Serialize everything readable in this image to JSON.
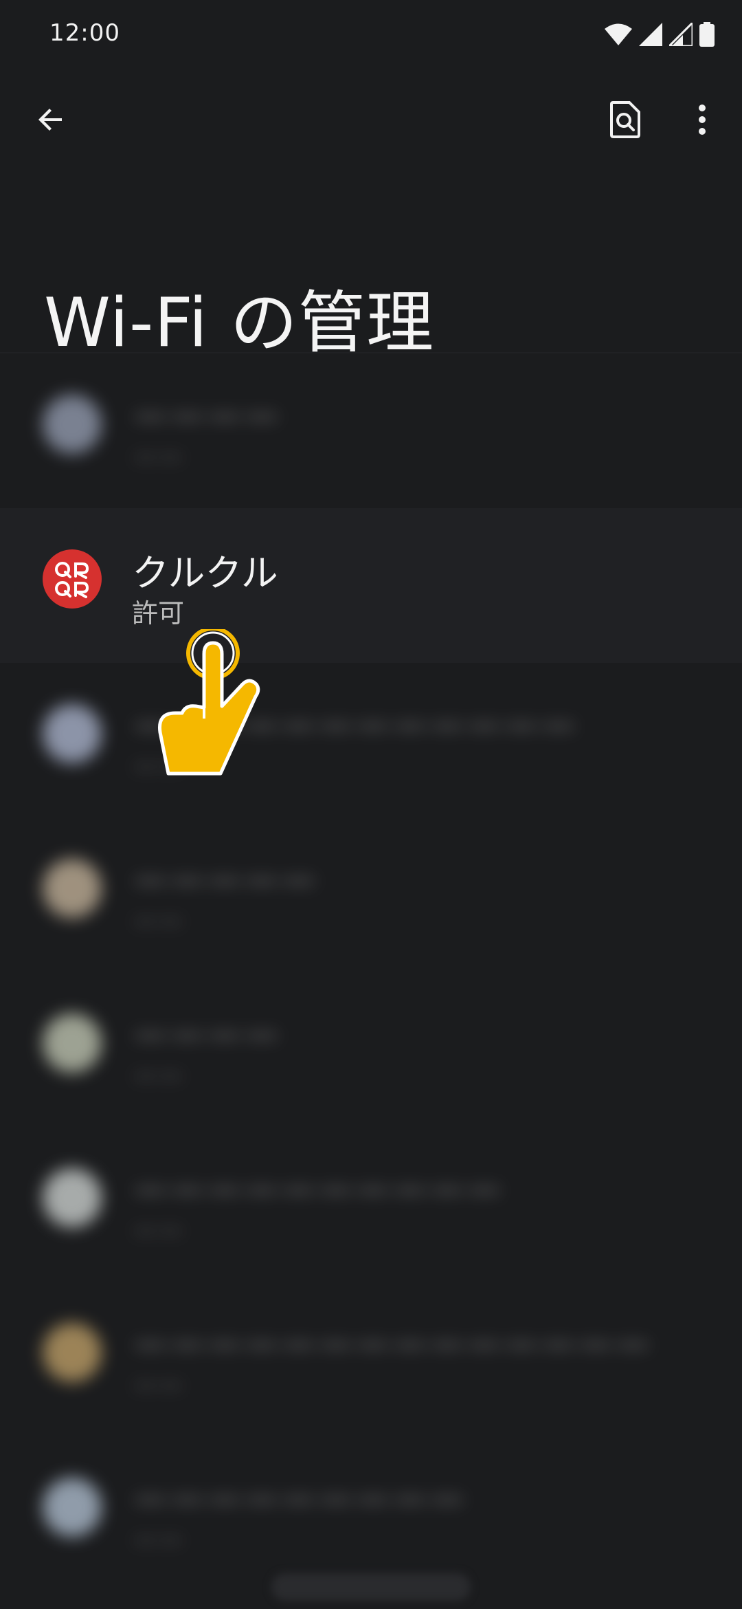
{
  "status_bar": {
    "time": "12:00",
    "icons": [
      "wifi-icon",
      "signal-full-icon",
      "signal-partial-icon",
      "battery-icon"
    ]
  },
  "app_bar": {
    "back_icon": "arrow-back-icon",
    "search_doc_icon": "search-document-icon",
    "more_icon": "more-vert-icon"
  },
  "title": "Wi-Fi の管理",
  "apps": [
    {
      "name": "ーーーー",
      "status": "ーー",
      "icon_color": "#9aa3b8",
      "blurred": true
    },
    {
      "name": "クルクル",
      "status": "許可",
      "icon_color": "#d6312f",
      "blurred": false,
      "icon": "qr-code-app-icon"
    },
    {
      "name": "ーーーーーーーーーーーー",
      "status": "ーー",
      "icon_color": "#b2bcd6",
      "blurred": true
    },
    {
      "name": "ーーーーー",
      "status": "ーー",
      "icon_color": "#cbb99f",
      "blurred": true
    },
    {
      "name": "ーーーー",
      "status": "ーー",
      "icon_color": "#c9cfba",
      "blurred": true
    },
    {
      "name": "ーーーーーーーーーー",
      "status": "ーー",
      "icon_color": "#d6dbd9",
      "blurred": true
    },
    {
      "name": "ーーーーーーーーーーーーーー",
      "status": "ーー",
      "icon_color": "#c7a66b",
      "blurred": true
    },
    {
      "name": "ーーーーーーーーー",
      "status": "ーー",
      "icon_color": "#b7c7d9",
      "blurred": true
    }
  ],
  "accent": "#f5b800"
}
